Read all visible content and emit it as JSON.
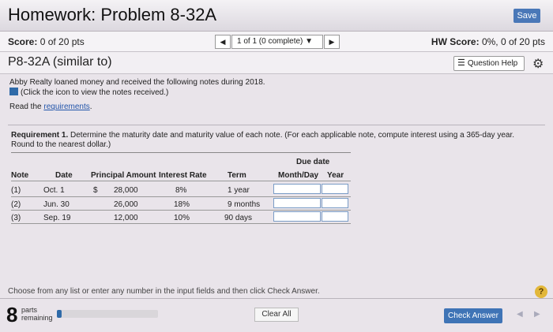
{
  "header": {
    "title": "Homework: Problem 8-32A",
    "save_label": "Save"
  },
  "scorebar": {
    "score_label": "Score:",
    "score_value": "0 of 20 pts",
    "nav_prev": "◀",
    "nav_selected": "1 of 1 (0 complete)",
    "nav_next": "▶",
    "hw_label": "HW Score:",
    "hw_value": "0%, 0 of 20 pts"
  },
  "problem": {
    "title": "P8-32A (similar to)",
    "help_label": "Question Help"
  },
  "intro": {
    "text": "Abby Realty loaned money and received the following notes during 2018.",
    "click_text": "(Click the icon to view the notes received.)",
    "read_prefix": "Read the ",
    "read_link": "requirements",
    "read_suffix": "."
  },
  "requirement": {
    "bold": "Requirement 1.",
    "text": " Determine the maturity date and maturity value of each note. (For each applicable note, compute interest using a 365-day year. Round to the nearest dollar.)"
  },
  "table": {
    "group_header": "Due date",
    "headers": {
      "note": "Note",
      "date": "Date",
      "principal": "Principal Amount",
      "rate": "Interest Rate",
      "term": "Term",
      "monthday": "Month/Day",
      "year": "Year"
    },
    "rows": [
      {
        "note": "(1)",
        "date": "Oct. 1",
        "dollar": "$",
        "principal": "28,000",
        "rate": "8%",
        "term": "1 year"
      },
      {
        "note": "(2)",
        "date": "Jun. 30",
        "dollar": "",
        "principal": "26,000",
        "rate": "18%",
        "term": "9 months"
      },
      {
        "note": "(3)",
        "date": "Sep. 19",
        "dollar": "",
        "principal": "12,000",
        "rate": "10%",
        "term": "90 days"
      }
    ]
  },
  "footer": {
    "instructions": "Choose from any list or enter any number in the input fields and then click Check Answer.",
    "help_symbol": "?",
    "parts_count": "8",
    "parts_label_1": "parts",
    "parts_label_2": "remaining",
    "progress_fraction": 0.05,
    "clear_label": "Clear All",
    "check_label": "Check Answer",
    "prev_arrow": "◀",
    "next_arrow": "▶"
  },
  "colors": {
    "accent": "#3f74b6",
    "title_bar": "#e6e2e8",
    "help_badge": "#e2b73a"
  },
  "icons": {
    "table": "table-icon",
    "gear": "gear-icon",
    "list": "list-icon"
  }
}
